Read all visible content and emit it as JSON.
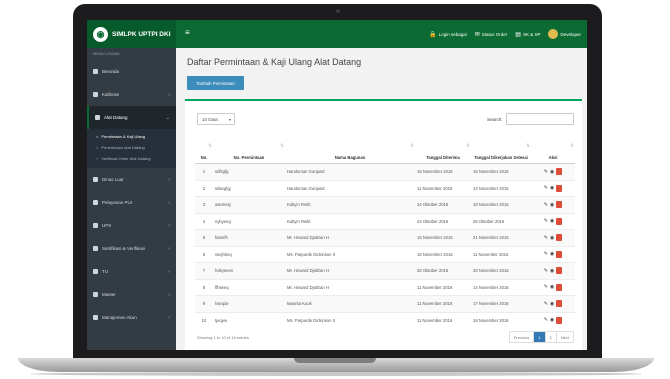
{
  "brand": {
    "logo_glyph": "◉",
    "name": "SIMLPK UPTPI DKI"
  },
  "topbar": {
    "menu_glyph": "≡",
    "links": [
      {
        "icon": "🔒",
        "label": "Login sebagai"
      },
      {
        "icon": "✉",
        "label": "Status Order"
      },
      {
        "icon": "▤",
        "label": "SK & SP"
      },
      {
        "icon": "",
        "label": "Developer"
      }
    ]
  },
  "sidebar": {
    "header": "MENU UTAMA",
    "items": [
      {
        "label": "Beranda",
        "arrow": ""
      },
      {
        "label": "Kalibrasi",
        "arrow": "‹"
      },
      {
        "label": "Alat Datang",
        "arrow": "‹"
      }
    ],
    "sub_items": [
      {
        "label": "Permintaan & Kaji Ulang"
      },
      {
        "label": "Penerimaan Alat Datang"
      },
      {
        "label": "Verifikasi Order Alat Datang"
      }
    ],
    "items_after": [
      {
        "label": "Dinas Luar",
        "arrow": "‹"
      },
      {
        "label": "Pelayanan PUI",
        "arrow": "‹"
      },
      {
        "label": "UPS",
        "arrow": "‹"
      },
      {
        "label": "Sertifikasi & Verifikasi",
        "arrow": "‹"
      },
      {
        "label": "TU",
        "arrow": "‹"
      },
      {
        "label": "Master",
        "arrow": "‹"
      },
      {
        "label": "Manajemen Akun",
        "arrow": "‹"
      }
    ]
  },
  "page": {
    "title": "Daftar Permintaan & Kaji Ulang Alat Datang",
    "add_button": "Tambah Permintaan",
    "length_value": "10 Data",
    "search_label": "Search:"
  },
  "table": {
    "headers": [
      "No.",
      "No. Permintaan",
      "Nama Bagunan",
      "Tanggal Diterima",
      "Tanggal Dikerjakan Selesai",
      "Aksi"
    ],
    "rows": [
      [
        "1",
        "sdfsgfg",
        "Handoman Gunjand",
        "16 November 2016",
        "16 November 2016"
      ],
      [
        "2",
        "sdsegfgj",
        "Handoman Gunjand",
        "11 November 2016",
        "14 November 2016"
      ],
      [
        "3",
        "asemesj",
        "Kaltym Rwht",
        "24 Oktober 2016",
        "18 November 2016"
      ],
      [
        "4",
        "nybyeeg",
        "Kaltym Rwht",
        "24 Oktober 2016",
        "25 Oktober 2016"
      ],
      [
        "5",
        "fatnefh",
        "Mr. Howard Djatlzan H",
        "16 November 2016",
        "21 November 2016"
      ],
      [
        "6",
        "ssejhheq",
        "Ms. Parpurde Dickinson II",
        "16 November 2016",
        "11 November 2016"
      ],
      [
        "7",
        "hdsyeeen",
        "Mr. Howard Djatlzan H",
        "26 Oktober 2016",
        "28 November 2016"
      ],
      [
        "8",
        "ffhseeq",
        "Mr. Howard Djatlzan H",
        "11 November 2016",
        "14 November 2016"
      ],
      [
        "9",
        "hseqde",
        "Maurita Kuok",
        "11 November 2016",
        "17 November 2016"
      ],
      [
        "10",
        "tjeqwe",
        "Ms. Parpurde Dickinson II",
        "11 November 2016",
        "18 November 2016"
      ]
    ]
  },
  "footer": {
    "info": "Showing 1 to 10 of 16 entries",
    "pages": [
      "Previous",
      "1",
      "2",
      "Next"
    ],
    "current_page": "1"
  },
  "colors": {
    "topbar": "#0b6b33",
    "sidebar": "#333c43",
    "primary_button": "#3c8dbc",
    "delete": "#dd4b39",
    "panel_accent": "#00a65a"
  }
}
